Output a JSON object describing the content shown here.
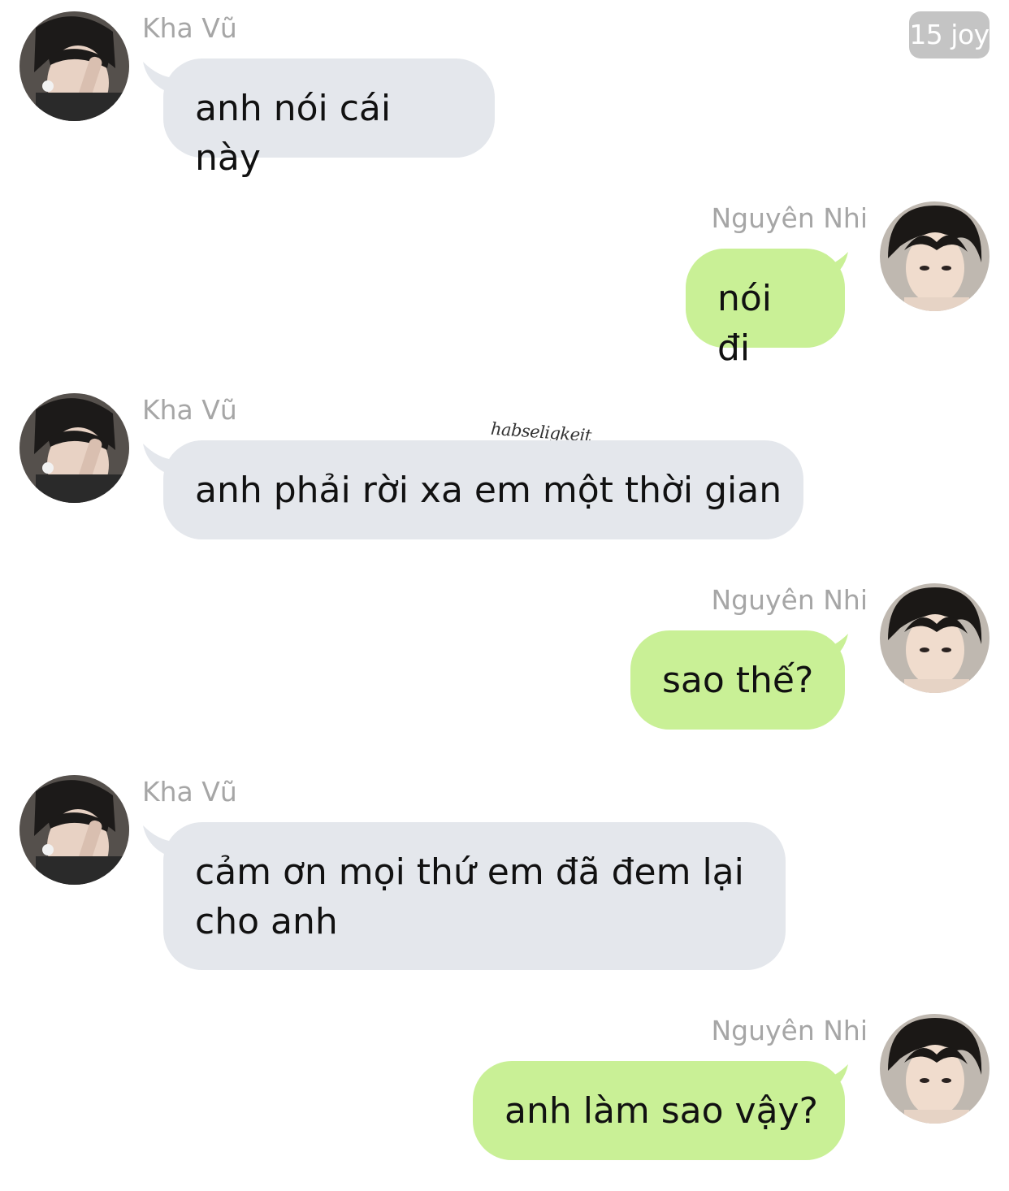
{
  "badge": {
    "text": "15 joy"
  },
  "watermark": {
    "text": "habseligkeit"
  },
  "colors": {
    "incoming_bubble": "#e4e7ec",
    "outgoing_bubble": "#c9f096",
    "sender_name": "#a6a6a6",
    "badge": "#c4c4c4"
  },
  "contacts": {
    "sender": {
      "name": "Kha Vũ",
      "avatar": "avatar-photo"
    },
    "receiver": {
      "name": "Nguyên Nhi",
      "avatar": "avatar-photo"
    }
  },
  "messages": [
    {
      "from": "Kha Vũ",
      "direction": "incoming",
      "name": "Kha Vũ",
      "text": "anh nói cái này"
    },
    {
      "from": "Nguyên Nhi",
      "direction": "outgoing",
      "name": "Nguyên Nhi",
      "text": "nói đi"
    },
    {
      "from": "Kha Vũ",
      "direction": "incoming",
      "name": "Kha Vũ",
      "text": "anh phải rời xa em một thời gian"
    },
    {
      "from": "Nguyên Nhi",
      "direction": "outgoing",
      "name": "Nguyên Nhi",
      "text": "sao thế?"
    },
    {
      "from": "Kha Vũ",
      "direction": "incoming",
      "name": "Kha Vũ",
      "text": "cảm ơn mọi thứ em đã đem lại cho anh"
    },
    {
      "from": "Nguyên Nhi",
      "direction": "outgoing",
      "name": "Nguyên Nhi",
      "text": "anh làm sao vậy?"
    }
  ]
}
